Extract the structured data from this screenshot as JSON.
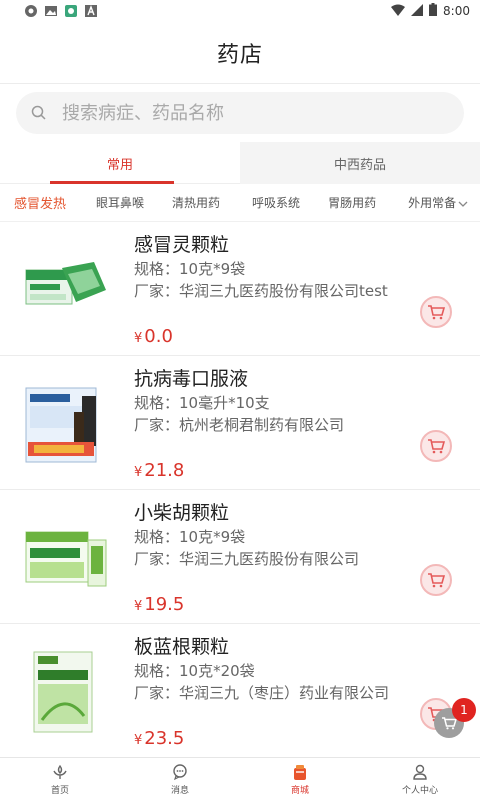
{
  "status": {
    "time": "8:00"
  },
  "header": {
    "title": "药店"
  },
  "search": {
    "placeholder": "搜索病症、药品名称"
  },
  "tabs": [
    {
      "label": "常用"
    },
    {
      "label": "中西药品"
    }
  ],
  "categories": [
    "感冒发热",
    "眼耳鼻喉",
    "清热用药",
    "呼吸系统",
    "胃肠用药",
    "外用常备"
  ],
  "products": [
    {
      "name": "感冒灵颗粒",
      "spec": "规格：10克*9袋",
      "maker": "厂家：华润三九医药股份有限公司test",
      "currency": "¥",
      "price": "0.0"
    },
    {
      "name": "抗病毒口服液",
      "spec": "规格：10毫升*10支",
      "maker": "厂家：杭州老桐君制药有限公司",
      "currency": "¥",
      "price": "21.8"
    },
    {
      "name": "小柴胡颗粒",
      "spec": "规格：10克*9袋",
      "maker": "厂家：华润三九医药股份有限公司",
      "currency": "¥",
      "price": "19.5"
    },
    {
      "name": "板蓝根颗粒",
      "spec": "规格：10克*20袋",
      "maker": "厂家：华润三九（枣庄）药业有限公司",
      "currency": "¥",
      "price": "23.5"
    }
  ],
  "cart": {
    "count": "1"
  },
  "bottom_nav": [
    {
      "label": "首页"
    },
    {
      "label": "消息"
    },
    {
      "label": "商城"
    },
    {
      "label": "个人中心"
    }
  ],
  "colors": {
    "accent": "#d9342b",
    "category_active": "#e3532d"
  }
}
